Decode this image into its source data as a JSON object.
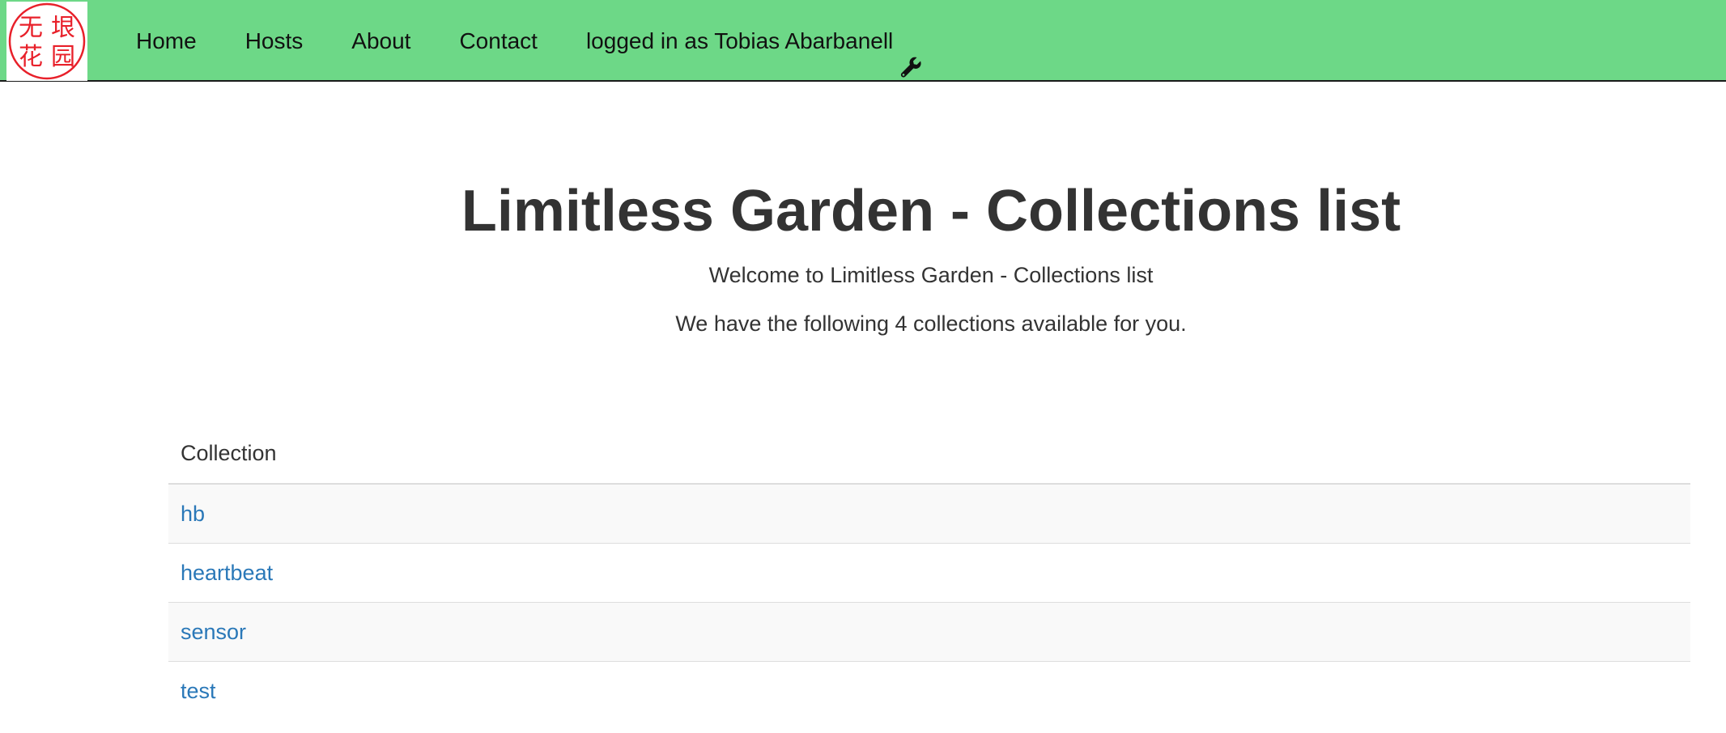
{
  "brand": {
    "logo_chars": [
      "无",
      "垠",
      "花",
      "园"
    ],
    "logo_color": "#e8202a"
  },
  "nav": {
    "items": [
      {
        "label": "Home"
      },
      {
        "label": "Hosts"
      },
      {
        "label": "About"
      },
      {
        "label": "Contact"
      }
    ],
    "user_label": "logged in as Tobias Abarbanell",
    "user_icon": "wrench-icon",
    "background_color": "#6dd887"
  },
  "main": {
    "title": "Limitless Garden - Collections list",
    "welcome": "Welcome to Limitless Garden - Collections list",
    "count_text": "We have the following 4 collections available for you."
  },
  "table": {
    "header": "Collection",
    "rows": [
      {
        "name": "hb"
      },
      {
        "name": "heartbeat"
      },
      {
        "name": "sensor"
      },
      {
        "name": "test"
      }
    ],
    "link_color": "#2a78b8"
  }
}
